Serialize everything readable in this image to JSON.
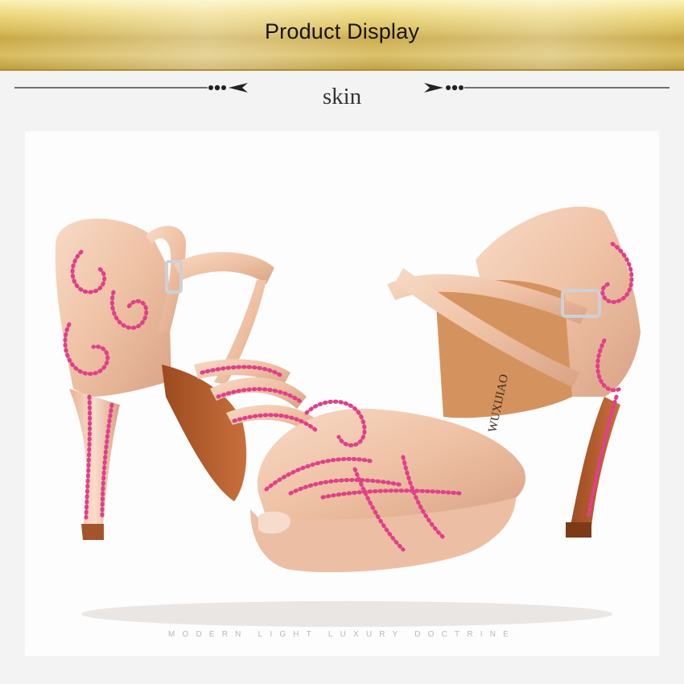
{
  "banner": {
    "title": "Product Display"
  },
  "section": {
    "color_name": "skin"
  },
  "product": {
    "brand_text": "WUXIJIAO",
    "tagline": "MODERN LIGHT LUXURY DOCTRINE",
    "image_icon": "dance-sandal-pair-image"
  },
  "colors": {
    "gold": "#d7bb58",
    "satin": "#f2c8ae",
    "rhinestone": "#e0408a",
    "sole": "#b05a2a",
    "background": "#f3f3f3"
  }
}
